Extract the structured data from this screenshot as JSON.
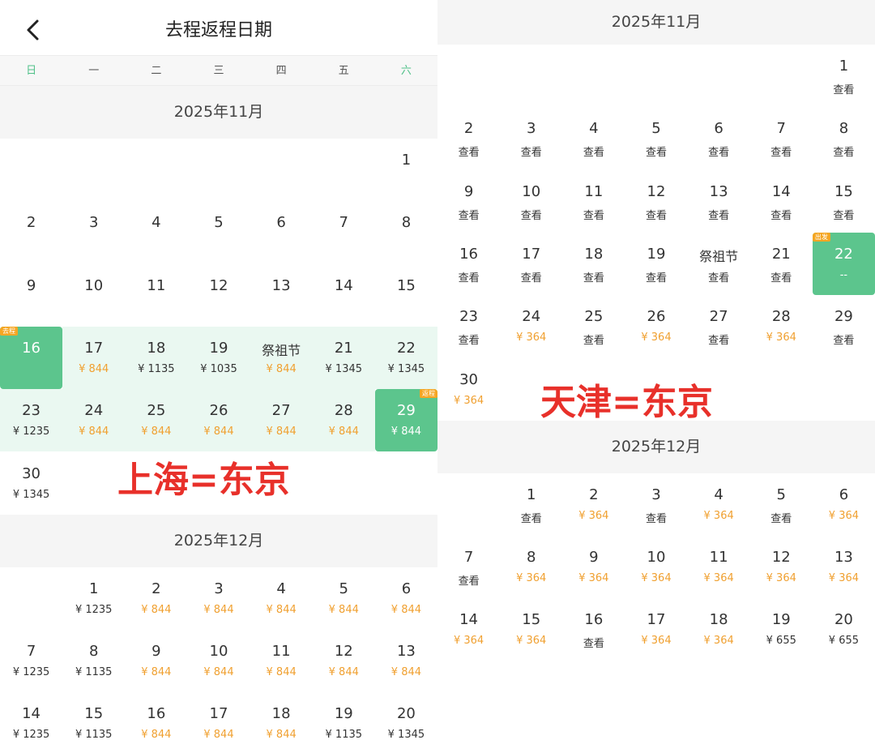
{
  "left": {
    "header": {
      "title": "去程返程日期"
    },
    "weekdays": [
      {
        "label": "日",
        "weekend": true
      },
      {
        "label": "一",
        "weekend": false
      },
      {
        "label": "二",
        "weekend": false
      },
      {
        "label": "三",
        "weekend": false
      },
      {
        "label": "四",
        "weekend": false
      },
      {
        "label": "五",
        "weekend": false
      },
      {
        "label": "六",
        "weekend": true
      }
    ],
    "route_label": "上海=东京",
    "colors": {
      "selected": "#5cc58d",
      "range": "#eaf8f1",
      "price_orange": "#f0a030",
      "tag": "#f5a623"
    },
    "months": [
      {
        "title": "2025年11月",
        "offset": 6,
        "days": [
          {
            "label": "1"
          },
          {
            "label": "2"
          },
          {
            "label": "3"
          },
          {
            "label": "4"
          },
          {
            "label": "5"
          },
          {
            "label": "6"
          },
          {
            "label": "7"
          },
          {
            "label": "8"
          },
          {
            "label": "9"
          },
          {
            "label": "10"
          },
          {
            "label": "11"
          },
          {
            "label": "12"
          },
          {
            "label": "13"
          },
          {
            "label": "14"
          },
          {
            "label": "15"
          },
          {
            "label": "16",
            "state": "selected",
            "tag": "去程",
            "tag_side": "left"
          },
          {
            "label": "17",
            "price": "¥ 844",
            "tone": "orange",
            "state": "range"
          },
          {
            "label": "18",
            "price": "¥ 1135",
            "tone": "black",
            "state": "range"
          },
          {
            "label": "19",
            "price": "¥ 1035",
            "tone": "black",
            "state": "range"
          },
          {
            "label": "祭祖节",
            "price": "¥ 844",
            "tone": "orange",
            "state": "range"
          },
          {
            "label": "21",
            "price": "¥ 1345",
            "tone": "black",
            "state": "range"
          },
          {
            "label": "22",
            "price": "¥ 1345",
            "tone": "black",
            "state": "range"
          },
          {
            "label": "23",
            "price": "¥ 1235",
            "tone": "black",
            "state": "range"
          },
          {
            "label": "24",
            "price": "¥ 844",
            "tone": "orange",
            "state": "range"
          },
          {
            "label": "25",
            "price": "¥ 844",
            "tone": "orange",
            "state": "range"
          },
          {
            "label": "26",
            "price": "¥ 844",
            "tone": "orange",
            "state": "range"
          },
          {
            "label": "27",
            "price": "¥ 844",
            "tone": "orange",
            "state": "range"
          },
          {
            "label": "28",
            "price": "¥ 844",
            "tone": "orange",
            "state": "range"
          },
          {
            "label": "29",
            "price": "¥ 844",
            "tone": "white",
            "state": "selected",
            "tag": "返程",
            "tag_side": "right"
          },
          {
            "label": "30",
            "price": "¥ 1345",
            "tone": "black"
          }
        ]
      },
      {
        "title": "2025年12月",
        "offset": 1,
        "days": [
          {
            "label": "1",
            "price": "¥ 1235",
            "tone": "black"
          },
          {
            "label": "2",
            "price": "¥ 844",
            "tone": "orange"
          },
          {
            "label": "3",
            "price": "¥ 844",
            "tone": "orange"
          },
          {
            "label": "4",
            "price": "¥ 844",
            "tone": "orange"
          },
          {
            "label": "5",
            "price": "¥ 844",
            "tone": "orange"
          },
          {
            "label": "6",
            "price": "¥ 844",
            "tone": "orange"
          },
          {
            "label": "7",
            "price": "¥ 1235",
            "tone": "black"
          },
          {
            "label": "8",
            "price": "¥ 1135",
            "tone": "black"
          },
          {
            "label": "9",
            "price": "¥ 844",
            "tone": "orange"
          },
          {
            "label": "10",
            "price": "¥ 844",
            "tone": "orange"
          },
          {
            "label": "11",
            "price": "¥ 844",
            "tone": "orange"
          },
          {
            "label": "12",
            "price": "¥ 844",
            "tone": "orange"
          },
          {
            "label": "13",
            "price": "¥ 844",
            "tone": "orange"
          },
          {
            "label": "14",
            "price": "¥ 1235",
            "tone": "black"
          },
          {
            "label": "15",
            "price": "¥ 1135",
            "tone": "black"
          },
          {
            "label": "16",
            "price": "¥ 844",
            "tone": "orange"
          },
          {
            "label": "17",
            "price": "¥ 844",
            "tone": "orange"
          },
          {
            "label": "18",
            "price": "¥ 844",
            "tone": "orange"
          },
          {
            "label": "19",
            "price": "¥ 1135",
            "tone": "black"
          },
          {
            "label": "20",
            "price": "¥ 1345",
            "tone": "black"
          }
        ]
      }
    ]
  },
  "right": {
    "route_label": "天津=东京",
    "months": [
      {
        "title": "2025年11月",
        "offset": 6,
        "days": [
          {
            "label": "1",
            "price": "查看",
            "tone": "black"
          },
          {
            "label": "2",
            "price": "查看",
            "tone": "black"
          },
          {
            "label": "3",
            "price": "查看",
            "tone": "black"
          },
          {
            "label": "4",
            "price": "查看",
            "tone": "black"
          },
          {
            "label": "5",
            "price": "查看",
            "tone": "black"
          },
          {
            "label": "6",
            "price": "查看",
            "tone": "black"
          },
          {
            "label": "7",
            "price": "查看",
            "tone": "black"
          },
          {
            "label": "8",
            "price": "查看",
            "tone": "black"
          },
          {
            "label": "9",
            "price": "查看",
            "tone": "black"
          },
          {
            "label": "10",
            "price": "查看",
            "tone": "black"
          },
          {
            "label": "11",
            "price": "查看",
            "tone": "black"
          },
          {
            "label": "12",
            "price": "查看",
            "tone": "black"
          },
          {
            "label": "13",
            "price": "查看",
            "tone": "black"
          },
          {
            "label": "14",
            "price": "查看",
            "tone": "black"
          },
          {
            "label": "15",
            "price": "查看",
            "tone": "black"
          },
          {
            "label": "16",
            "price": "查看",
            "tone": "black"
          },
          {
            "label": "17",
            "price": "查看",
            "tone": "black"
          },
          {
            "label": "18",
            "price": "查看",
            "tone": "black"
          },
          {
            "label": "19",
            "price": "查看",
            "tone": "black"
          },
          {
            "label": "祭祖节",
            "price": "查看",
            "tone": "black"
          },
          {
            "label": "21",
            "price": "查看",
            "tone": "black"
          },
          {
            "label": "22",
            "price": "--",
            "tone": "white",
            "state": "selected",
            "tag": "出发",
            "tag_side": "left"
          },
          {
            "label": "23",
            "price": "查看",
            "tone": "black"
          },
          {
            "label": "24",
            "price": "¥ 364",
            "tone": "orange"
          },
          {
            "label": "25",
            "price": "查看",
            "tone": "black"
          },
          {
            "label": "26",
            "price": "¥ 364",
            "tone": "orange"
          },
          {
            "label": "27",
            "price": "查看",
            "tone": "black"
          },
          {
            "label": "28",
            "price": "¥ 364",
            "tone": "orange"
          },
          {
            "label": "29",
            "price": "查看",
            "tone": "black"
          },
          {
            "label": "30",
            "price": "¥ 364",
            "tone": "orange"
          }
        ]
      },
      {
        "title": "2025年12月",
        "offset": 1,
        "days": [
          {
            "label": "1",
            "price": "查看",
            "tone": "black"
          },
          {
            "label": "2",
            "price": "¥ 364",
            "tone": "orange"
          },
          {
            "label": "3",
            "price": "查看",
            "tone": "black"
          },
          {
            "label": "4",
            "price": "¥ 364",
            "tone": "orange"
          },
          {
            "label": "5",
            "price": "查看",
            "tone": "black"
          },
          {
            "label": "6",
            "price": "¥ 364",
            "tone": "orange"
          },
          {
            "label": "7",
            "price": "查看",
            "tone": "black"
          },
          {
            "label": "8",
            "price": "¥ 364",
            "tone": "orange"
          },
          {
            "label": "9",
            "price": "¥ 364",
            "tone": "orange"
          },
          {
            "label": "10",
            "price": "¥ 364",
            "tone": "orange"
          },
          {
            "label": "11",
            "price": "¥ 364",
            "tone": "orange"
          },
          {
            "label": "12",
            "price": "¥ 364",
            "tone": "orange"
          },
          {
            "label": "13",
            "price": "¥ 364",
            "tone": "orange"
          },
          {
            "label": "14",
            "price": "¥ 364",
            "tone": "orange"
          },
          {
            "label": "15",
            "price": "¥ 364",
            "tone": "orange"
          },
          {
            "label": "16",
            "price": "查看",
            "tone": "black"
          },
          {
            "label": "17",
            "price": "¥ 364",
            "tone": "orange"
          },
          {
            "label": "18",
            "price": "¥ 364",
            "tone": "orange"
          },
          {
            "label": "19",
            "price": "¥ 655",
            "tone": "black"
          },
          {
            "label": "20",
            "price": "¥ 655",
            "tone": "black"
          }
        ]
      }
    ]
  }
}
